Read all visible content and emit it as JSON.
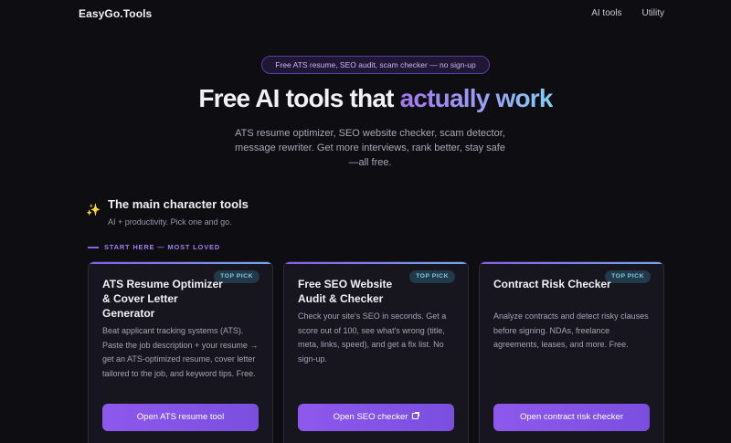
{
  "nav": {
    "brand": "EasyGo.Tools",
    "links": [
      "AI tools",
      "Utility"
    ]
  },
  "hero": {
    "pill": "Free ATS resume, SEO audit, scam checker — no sign-up",
    "title_plain": "Free AI tools that ",
    "title_accent": "actually work",
    "subtitle": "ATS resume optimizer, SEO website checker, scam detector, message rewriter. Get more interviews, rank better, stay safe—all free."
  },
  "section": {
    "icon": "sparkles-icon",
    "title": "The main character tools",
    "subtitle": "AI + productivity. Pick one and go.",
    "label": "START HERE — MOST LOVED"
  },
  "cards": [
    {
      "badge": "TOP PICK",
      "title": "ATS Resume Optimizer & Cover Letter Generator",
      "desc": "Beat applicant tracking systems (ATS). Paste the job description + your resume → get an ATS-optimized resume, cover letter tailored to the job, and keyword tips. Free.",
      "button": "Open ATS resume tool"
    },
    {
      "badge": "TOP PICK",
      "title": "Free SEO Website Audit & Checker",
      "desc": "Check your site's SEO in seconds. Get a score out of 100, see what's wrong (title, meta, links, speed), and get a fix list. No sign-up.",
      "button": "Open SEO checker"
    },
    {
      "badge": "TOP PICK",
      "title": "Contract Risk Checker",
      "desc": "Analyze contracts and detect risky clauses before signing. NDAs, freelance agreements, leases, and more. Free.",
      "button": "Open contract risk checker"
    }
  ],
  "colors": {
    "background": "#0d0d12",
    "accent": "#8e58ec",
    "badge_text": "#7fc7e6"
  }
}
